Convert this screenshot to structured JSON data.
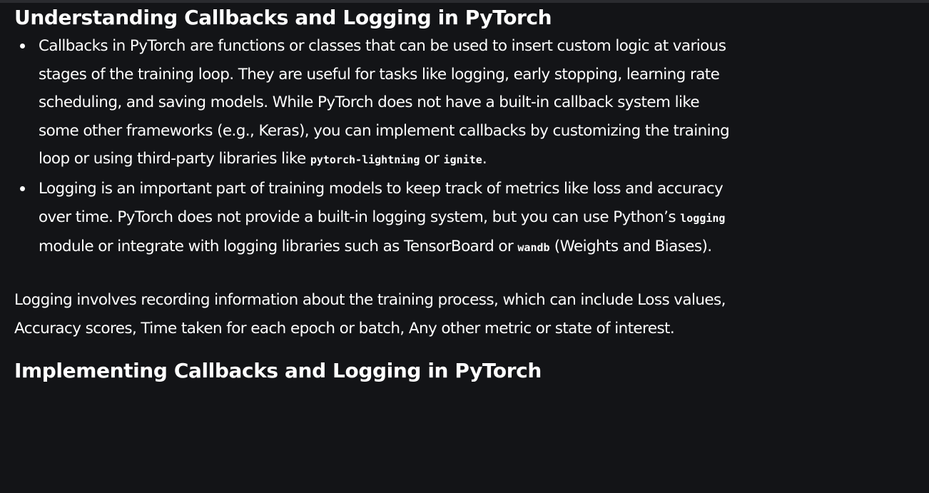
{
  "heading1": "Understanding Callbacks and Logging in PyTorch",
  "bullets": [
    {
      "text_a": "Callbacks in PyTorch are functions or classes that can be used to insert custom logic at various stages of the training loop. They are useful for tasks like logging, early stopping, learning rate scheduling, and saving models. While PyTorch does not have a built-in callback system like some other frameworks (e.g., Keras), you can implement callbacks by customizing the training loop or using third-party libraries like ",
      "code_a": "pytorch-lightning",
      "text_b": " or ",
      "code_b": "ignite",
      "text_c": "."
    },
    {
      "text_a": "Logging is an important part of training models to keep track of metrics like loss and accuracy over time. PyTorch does not provide a built-in logging system, but you can use Python’s ",
      "code_a": "logging",
      "text_b": " module or integrate with logging libraries such as TensorBoard or ",
      "code_b": "wandb",
      "text_c": " (Weights and Biases)."
    }
  ],
  "paragraph": "Logging involves recording information about the training process, which can include Loss values, Accuracy scores, Time taken for each epoch or batch, Any other metric or state of interest.",
  "heading2": "Implementing Callbacks and Logging in PyTorch"
}
